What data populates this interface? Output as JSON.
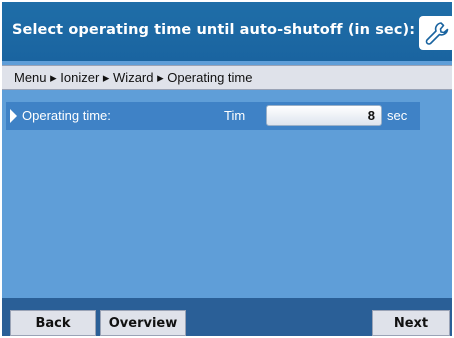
{
  "header": {
    "title": "Select operating time until auto-shutoff (in sec):",
    "icon": "wrench-icon"
  },
  "breadcrumb": {
    "text": "Menu ▸ Ionizer ▸ Wizard ▸ Operating time"
  },
  "settings": {
    "row": {
      "label": "Operating time:",
      "code": "Tim",
      "value": "8",
      "unit": "sec"
    }
  },
  "footer": {
    "back_label": "Back",
    "overview_label": "Overview",
    "next_label": "Next"
  },
  "colors": {
    "header_bg": "#1f6ea8",
    "content_bg": "#5f9ed8",
    "selected_row_bg": "#3f82c6",
    "footer_bg": "#2a5f97",
    "button_bg": "#dfe2ea"
  }
}
